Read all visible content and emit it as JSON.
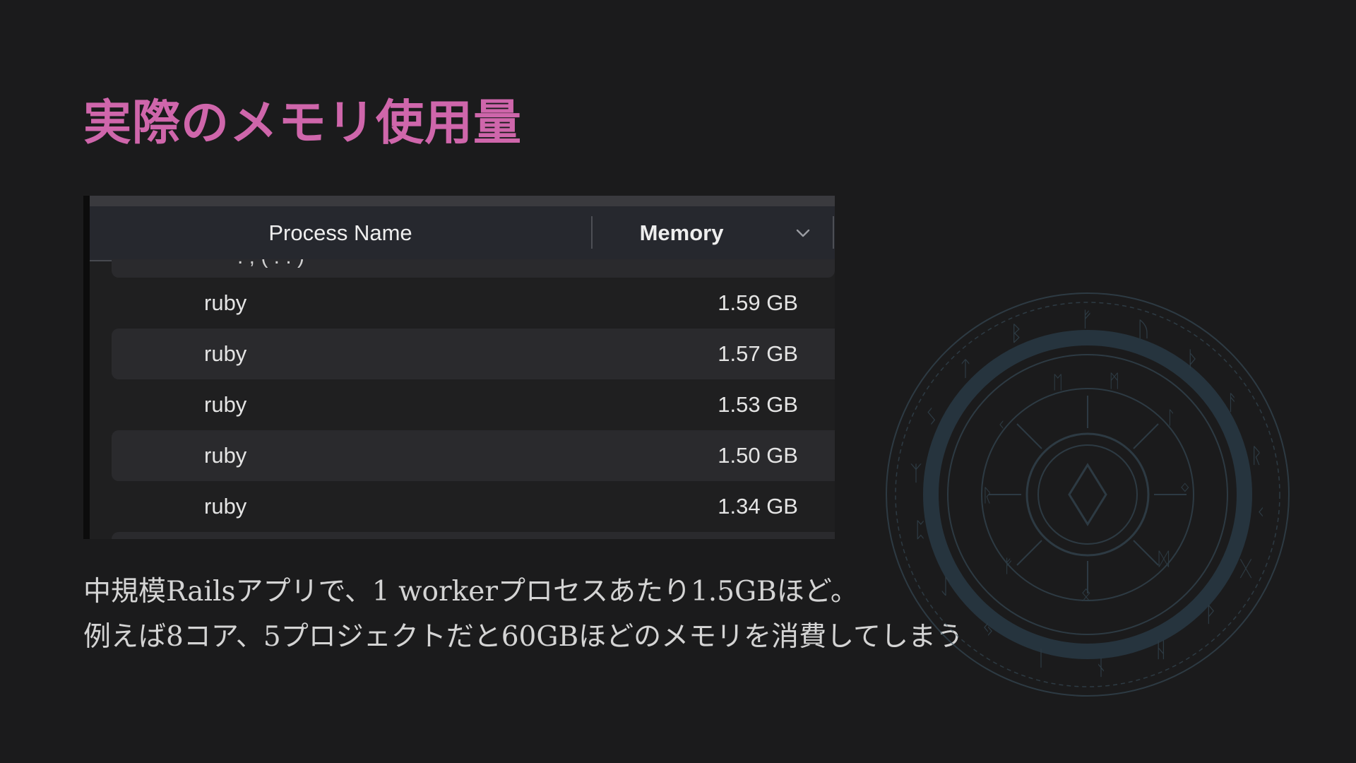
{
  "slide": {
    "title": "実際のメモリ使用量"
  },
  "process_table": {
    "columns": {
      "process_name": "Process Name",
      "memory": "Memory"
    },
    "sort_icon": "chevron-down-icon",
    "rows": [
      {
        "name": "ruby",
        "memory": "1.59 GB"
      },
      {
        "name": "ruby",
        "memory": "1.57 GB"
      },
      {
        "name": "ruby",
        "memory": "1.53 GB"
      },
      {
        "name": "ruby",
        "memory": "1.50 GB"
      },
      {
        "name": "ruby",
        "memory": "1.34 GB"
      }
    ]
  },
  "body": {
    "line1": "中規模Railsアプリで、1 workerプロセスあたり1.5GBほど。",
    "line2": "例えば8コア、5プロジェクトだと60GBほどのメモリを消費してしまう"
  },
  "decoration": {
    "icon": "rune-circle-icon",
    "color": "#3c5563"
  },
  "colors": {
    "background": "#1b1b1c",
    "title": "#cf66ab",
    "body_text": "#d4d4d4",
    "table_header": "#26282e",
    "row_stripe": "#2a2a2d"
  }
}
